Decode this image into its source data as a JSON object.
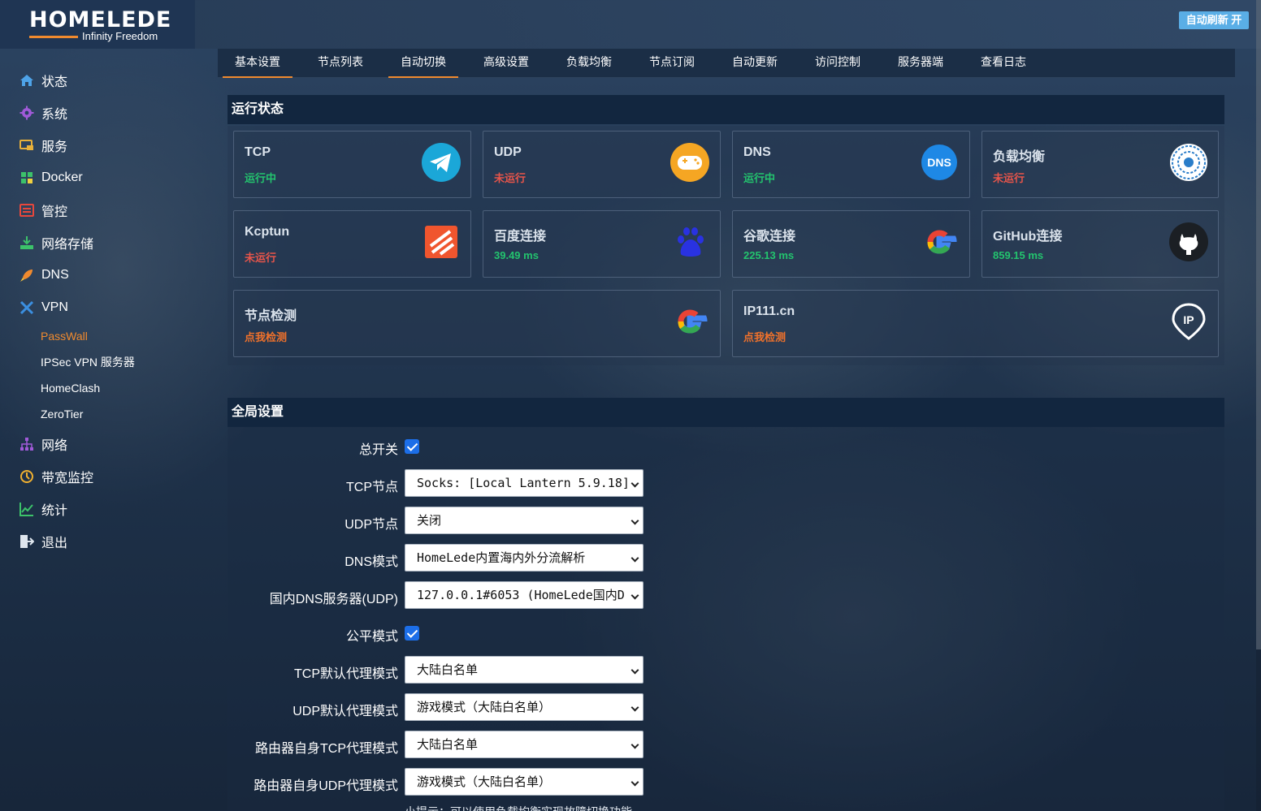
{
  "header": {
    "logo_main": "HOMELEDE",
    "logo_sub": "Infinity Freedom",
    "refresh_label": "自动刷新 开"
  },
  "sidebar": {
    "items": [
      {
        "label": "状态",
        "icon": "home-icon"
      },
      {
        "label": "系统",
        "icon": "gear-icon"
      },
      {
        "label": "服务",
        "icon": "services-icon"
      },
      {
        "label": "Docker",
        "icon": "docker-icon"
      },
      {
        "label": "管控",
        "icon": "control-icon"
      },
      {
        "label": "网络存储",
        "icon": "storage-icon"
      },
      {
        "label": "DNS",
        "icon": "rocket-icon"
      },
      {
        "label": "VPN",
        "icon": "vpn-icon"
      },
      {
        "label": "网络",
        "icon": "network-icon"
      },
      {
        "label": "带宽监控",
        "icon": "bandwidth-icon"
      },
      {
        "label": "统计",
        "icon": "chart-icon"
      },
      {
        "label": "退出",
        "icon": "logout-icon"
      }
    ],
    "vpn_sub": [
      "PassWall",
      "IPSec VPN 服务器",
      "HomeClash",
      "ZeroTier"
    ]
  },
  "tabs": [
    "基本设置",
    "节点列表",
    "自动切换",
    "高级设置",
    "负载均衡",
    "节点订阅",
    "自动更新",
    "访问控制",
    "服务器端",
    "查看日志"
  ],
  "status": {
    "title": "运行状态",
    "cards": [
      {
        "title": "TCP",
        "status": "运行中",
        "icon": "telegram-icon"
      },
      {
        "title": "UDP",
        "status": "未运行",
        "icon": "gamepad-icon"
      },
      {
        "title": "DNS",
        "status": "运行中",
        "icon": "dns-icon",
        "icon_text": "DNS"
      },
      {
        "title": "负载均衡",
        "status": "未运行",
        "icon": "haproxy-icon"
      },
      {
        "title": "Kcptun",
        "status": "未运行",
        "icon": "kcptun-icon"
      },
      {
        "title": "百度连接",
        "status": "39.49 ms",
        "icon": "baidu-paw-icon"
      },
      {
        "title": "谷歌连接",
        "status": "225.13 ms",
        "icon": "google-icon"
      },
      {
        "title": "GitHub连接",
        "status": "859.15 ms",
        "icon": "github-icon"
      },
      {
        "title": "节点检测",
        "status": "点我检测",
        "icon": "google-icon"
      },
      {
        "title": "IP111.cn",
        "status": "点我检测",
        "icon": "ip-pin-icon",
        "icon_text": "IP"
      }
    ],
    "colors": {
      "running": "#23c46e",
      "stopped": "#e9554a",
      "link": "#f0712b"
    }
  },
  "global": {
    "title": "全局设置",
    "master_switch_label": "总开关",
    "tcp_node_label": "TCP节点",
    "tcp_node_value": "Socks: [Local Lantern 5.9.18]",
    "udp_node_label": "UDP节点",
    "udp_node_value": "关闭",
    "dns_mode_label": "DNS模式",
    "dns_mode_value": "HomeLede内置海内外分流解析",
    "domestic_dns_label": "国内DNS服务器(UDP)",
    "domestic_dns_value": "127.0.0.1#6053 (HomeLede国内D",
    "fair_mode_label": "公平模式",
    "tcp_proxy_label": "TCP默认代理模式",
    "tcp_proxy_value": "大陆白名单",
    "udp_proxy_label": "UDP默认代理模式",
    "udp_proxy_value": "游戏模式（大陆白名单）",
    "router_tcp_label": "路由器自身TCP代理模式",
    "router_tcp_value": "大陆白名单",
    "router_udp_label": "路由器自身UDP代理模式",
    "router_udp_value": "游戏模式（大陆白名单）",
    "hint": "小提示：可以使用负载均衡实现故障切换功能"
  }
}
